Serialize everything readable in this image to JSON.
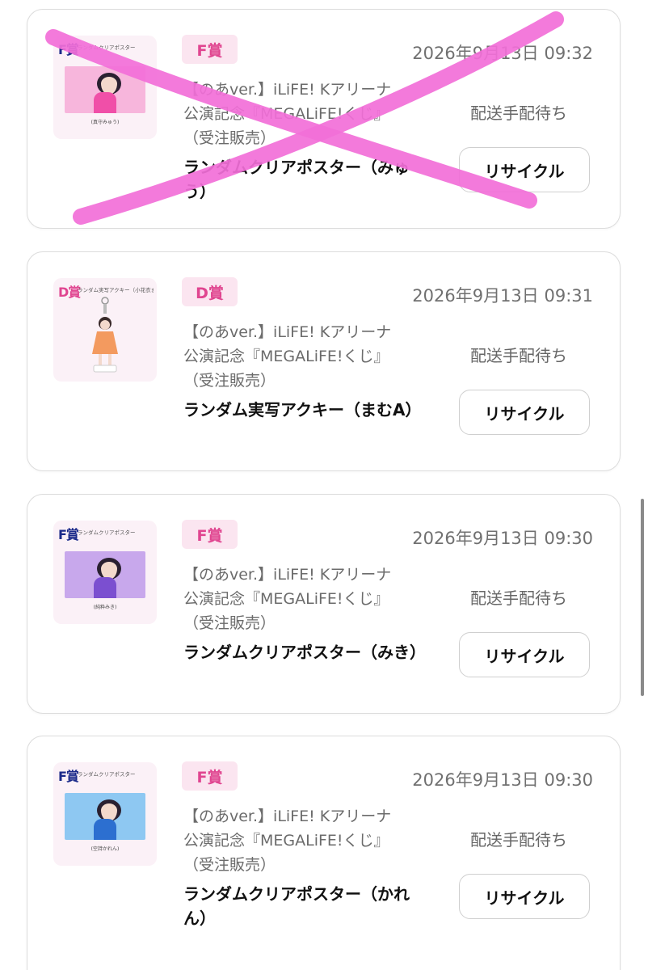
{
  "orders": [
    {
      "prize": "F賞",
      "thumb_prize": "F賞",
      "thumb_title": "ランダムクリアポスター",
      "thumb_caption": "(真守みゅう)",
      "thumb_prize_color": "#1b2a8a",
      "art_bg": "#f7b6dc",
      "art_body": "#f04fa8",
      "date": "2026年9月13日 09:32",
      "lottery_lines": [
        "【のあver.】iLiFE! Kアリーナ",
        "公演記念『MEGALiFE!くじ』",
        "（受注販売）"
      ],
      "item_name": "ランダムクリアポスター（みゅう）",
      "status": "配送手配待ち",
      "recycle_label": "リサイクル",
      "crossed_out": true
    },
    {
      "prize": "D賞",
      "thumb_prize": "D賞",
      "thumb_title": "ランダム実写アクキー（小花衣まむA）",
      "thumb_caption": "",
      "thumb_prize_color": "#e04590",
      "art_bg": "",
      "art_body": "#f39a5f",
      "date": "2026年9月13日 09:31",
      "lottery_lines": [
        "【のあver.】iLiFE! Kアリーナ",
        "公演記念『MEGALiFE!くじ』",
        "（受注販売）"
      ],
      "item_name": "ランダム実写アクキー（まむA）",
      "status": "配送手配待ち",
      "recycle_label": "リサイクル",
      "crossed_out": false
    },
    {
      "prize": "F賞",
      "thumb_prize": "F賞",
      "thumb_title": "ランダムクリアポスター",
      "thumb_caption": "(純粋みき)",
      "thumb_prize_color": "#1b2a8a",
      "art_bg": "#c8a8ec",
      "art_body": "#7b4fd0",
      "date": "2026年9月13日 09:30",
      "lottery_lines": [
        "【のあver.】iLiFE! Kアリーナ",
        "公演記念『MEGALiFE!くじ』",
        "（受注販売）"
      ],
      "item_name": "ランダムクリアポスター（みき）",
      "status": "配送手配待ち",
      "recycle_label": "リサイクル",
      "crossed_out": false
    },
    {
      "prize": "F賞",
      "thumb_prize": "F賞",
      "thumb_title": "ランダムクリアポスター",
      "thumb_caption": "(空詩かれん)",
      "thumb_prize_color": "#1b2a8a",
      "art_bg": "#8ec8f2",
      "art_body": "#2c6fd0",
      "date": "2026年9月13日 09:30",
      "lottery_lines": [
        "【のあver.】iLiFE! Kアリーナ",
        "公演記念『MEGALiFE!くじ』",
        "（受注販売）"
      ],
      "item_name": "ランダムクリアポスター（かれん）",
      "status": "配送手配待ち",
      "recycle_label": "リサイクル",
      "crossed_out": false
    }
  ],
  "annotation_color": "#f26fd8"
}
